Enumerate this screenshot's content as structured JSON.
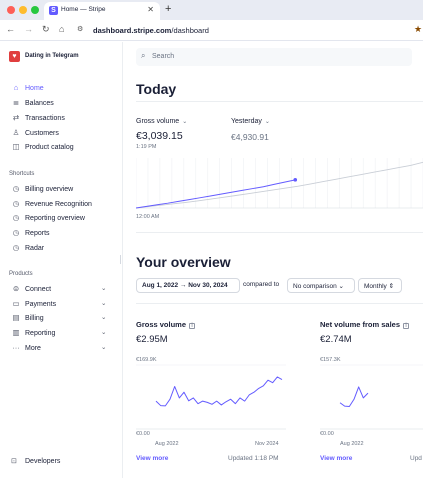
{
  "browser": {
    "tab_title": "Home — Stripe",
    "tab_favicon": "S",
    "url_domain": "dashboard.stripe.com",
    "url_path": "/dashboard"
  },
  "sidebar": {
    "account_name": "Dating in Telegram",
    "nav": [
      {
        "label": "Home",
        "icon": "home-icon",
        "active": true
      },
      {
        "label": "Balances",
        "icon": "balances-icon"
      },
      {
        "label": "Transactions",
        "icon": "transactions-icon"
      },
      {
        "label": "Customers",
        "icon": "customers-icon"
      },
      {
        "label": "Product catalog",
        "icon": "product-catalog-icon"
      }
    ],
    "shortcuts_label": "Shortcuts",
    "shortcuts": [
      {
        "label": "Billing overview",
        "icon": "clock-icon"
      },
      {
        "label": "Revenue Recognition",
        "icon": "clock-icon"
      },
      {
        "label": "Reporting overview",
        "icon": "clock-icon"
      },
      {
        "label": "Reports",
        "icon": "clock-icon"
      },
      {
        "label": "Radar",
        "icon": "clock-icon"
      }
    ],
    "products_label": "Products",
    "products": [
      {
        "label": "Connect",
        "icon": "connect-icon"
      },
      {
        "label": "Payments",
        "icon": "payments-icon"
      },
      {
        "label": "Billing",
        "icon": "billing-icon"
      },
      {
        "label": "Reporting",
        "icon": "reporting-icon"
      },
      {
        "label": "More",
        "icon": "more-icon"
      }
    ],
    "developers_label": "Developers"
  },
  "search": {
    "placeholder": "Search"
  },
  "today": {
    "heading": "Today",
    "gross_volume_label": "Gross volume",
    "gross_volume_value": "€3,039.15",
    "gross_volume_time": "1:19 PM",
    "yesterday_label": "Yesterday",
    "yesterday_value": "€4,930.91",
    "axis_start": "12:00 AM"
  },
  "overview": {
    "heading": "Your overview",
    "date_range": "Aug 1, 2022 → Nov 30, 2024",
    "compared_to": "compared to",
    "comparison": "No comparison",
    "interval": "Monthly"
  },
  "cards": [
    {
      "title": "Gross volume",
      "value": "€2.95M",
      "y_top": "€169.9K",
      "y_bottom": "€0.00",
      "x_start": "Aug 2022",
      "x_end": "Nov 2024",
      "view_more": "View more",
      "updated": "Updated 1:18 PM"
    },
    {
      "title": "Net volume from sales",
      "value": "€2.74M",
      "y_top": "€157.3K",
      "y_bottom": "€0.00",
      "x_start": "Aug 2022",
      "view_more": "View more",
      "updated": "Upd"
    }
  ],
  "colors": {
    "accent": "#635bff",
    "brand_logo": "#e03e3e"
  },
  "chart_data": [
    {
      "type": "line",
      "title": "Gross volume",
      "x_range": [
        "Aug 2022",
        "Nov 2024"
      ],
      "ylim": [
        0,
        169900
      ],
      "series": [
        {
          "values": [
            72000,
            58000,
            57000,
            78000,
            118000,
            82000,
            100000,
            73000,
            82000,
            64000,
            72000,
            68000,
            62000,
            72000,
            60000,
            70000,
            78000,
            64000,
            82000,
            72000,
            92000,
            100000,
            112000,
            120000,
            138000,
            130000,
            148000,
            140000
          ]
        }
      ]
    },
    {
      "type": "line",
      "title": "Net volume from sales",
      "x_range": [
        "Aug 2022",
        "Nov 2024"
      ],
      "ylim": [
        0,
        157300
      ],
      "series": [
        {
          "values": [
            62000,
            52000,
            51000,
            72000,
            108000,
            76000,
            90000
          ]
        }
      ]
    },
    {
      "type": "line",
      "title": "Gross volume",
      "x_range": [
        "12:00 AM",
        "1:19 PM"
      ],
      "series": [
        {
          "name": "Gross volume",
          "values": [
            0,
            180,
            350,
            520,
            720,
            900,
            1100,
            1300,
            1500,
            1700,
            1900,
            2100,
            2300,
            2550,
            2800,
            3039.15
          ]
        },
        {
          "name": "Yesterday",
          "values": [
            0,
            150,
            300,
            450,
            600,
            780,
            960,
            1150,
            1350,
            1550,
            1750,
            1950,
            2150,
            2350,
            2600,
            2850,
            3100,
            3350,
            3600,
            3850,
            4100,
            4350,
            4600,
            4930.91
          ]
        }
      ]
    }
  ]
}
